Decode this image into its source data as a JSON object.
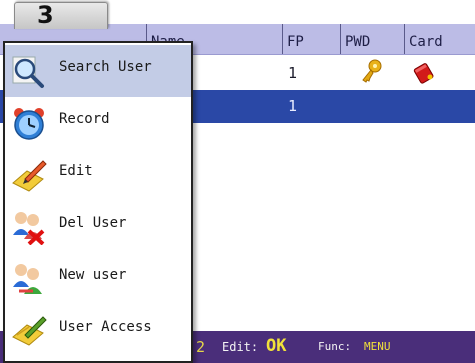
{
  "tab_number": "3",
  "table": {
    "headers": {
      "name": "Name",
      "fp": "FP",
      "pwd": "PWD",
      "card": "Card"
    },
    "rows": [
      {
        "fp": "1",
        "pwd_icon": "key-icon",
        "card_icon": "card-icon",
        "selected": false
      },
      {
        "fp": "1",
        "selected": true
      }
    ]
  },
  "menu": {
    "items": [
      {
        "label": "Search User",
        "icon": "search-user-icon",
        "active": true
      },
      {
        "label": "Record",
        "icon": "clock-icon"
      },
      {
        "label": "Edit",
        "icon": "edit-icon"
      },
      {
        "label": "Del User",
        "icon": "delete-user-icon"
      },
      {
        "label": "New user",
        "icon": "new-user-icon"
      },
      {
        "label": "User Access",
        "icon": "user-access-icon"
      }
    ]
  },
  "status_bar": {
    "count": "2",
    "edit_label": "Edit:",
    "edit_key": "OK",
    "func_label": "Func:",
    "func_key": "MENU"
  },
  "colors": {
    "header": "#bcbce6",
    "selected_row": "#2a48a6",
    "status_bar": "#4a2e7a",
    "menu_highlight": "#c3cce6"
  }
}
